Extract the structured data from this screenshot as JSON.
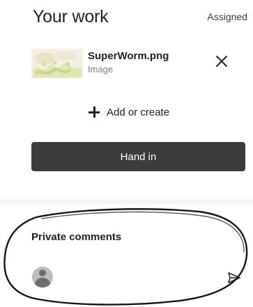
{
  "header": {
    "title": "Your work",
    "status": "Assigned"
  },
  "attachment": {
    "filename": "SuperWorm.png",
    "type": "Image",
    "thumbnail_icon": "image-thumbnail",
    "remove_icon": "close-icon"
  },
  "actions": {
    "add_label": "Add or create",
    "add_icon": "plus-icon",
    "hand_in_label": "Hand in"
  },
  "private_comments": {
    "title": "Private comments",
    "input_placeholder": "",
    "avatar_icon": "avatar-icon",
    "send_icon": "send-icon"
  },
  "colors": {
    "button_bg": "#3c3c3c",
    "text": "#202124",
    "secondary_text": "#7a7f85"
  }
}
